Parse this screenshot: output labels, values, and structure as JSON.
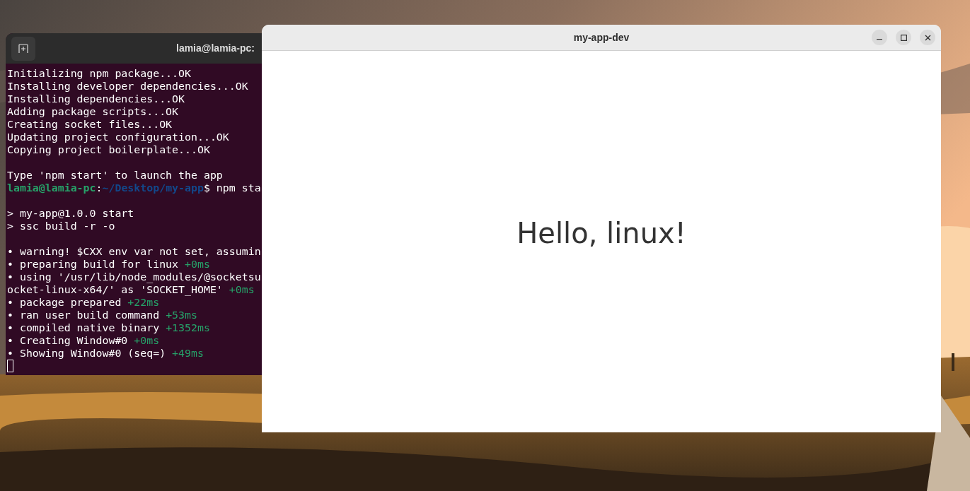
{
  "terminal": {
    "title": "lamia@lamia-pc:",
    "blocks": [
      [
        [
          {
            "text": "Initializing npm package...OK",
            "kind": "plain"
          }
        ],
        [
          {
            "text": "Installing developer dependencies...OK",
            "kind": "plain"
          }
        ],
        [
          {
            "text": "Installing dependencies...OK",
            "kind": "plain"
          }
        ],
        [
          {
            "text": "Adding package scripts...OK",
            "kind": "plain"
          }
        ],
        [
          {
            "text": "Creating socket files...OK",
            "kind": "plain"
          }
        ],
        [
          {
            "text": "Updating project configuration...OK",
            "kind": "plain"
          }
        ],
        [
          {
            "text": "Copying project boilerplate...OK",
            "kind": "plain"
          }
        ]
      ],
      [
        [
          {
            "text": "Type 'npm start' to launch the app",
            "kind": "plain"
          }
        ],
        [
          {
            "text": "lamia@lamia-pc",
            "kind": "user"
          },
          {
            "text": ":",
            "kind": "plain"
          },
          {
            "text": "~/Desktop/my-app",
            "kind": "path"
          },
          {
            "text": "$ npm sta",
            "kind": "plain"
          }
        ]
      ],
      [
        [
          {
            "text": "> my-app@1.0.0 start",
            "kind": "plain"
          }
        ],
        [
          {
            "text": "> ssc build -r -o",
            "kind": "plain"
          }
        ]
      ],
      [
        [
          {
            "text": "• warning! $CXX env var not set, assumin",
            "kind": "plain"
          }
        ],
        [
          {
            "text": "• preparing build for linux ",
            "kind": "plain"
          },
          {
            "text": "+0ms",
            "kind": "timing"
          }
        ],
        [
          {
            "text": "• using '/usr/lib/node_modules/@socketsu",
            "kind": "plain"
          }
        ],
        [
          {
            "text": "ocket-linux-x64/' as 'SOCKET_HOME' ",
            "kind": "plain"
          },
          {
            "text": "+0ms",
            "kind": "timing"
          }
        ],
        [
          {
            "text": "• package prepared ",
            "kind": "plain"
          },
          {
            "text": "+22ms",
            "kind": "timing"
          }
        ],
        [
          {
            "text": "• ran user build command ",
            "kind": "plain"
          },
          {
            "text": "+53ms",
            "kind": "timing"
          }
        ],
        [
          {
            "text": "• compiled native binary ",
            "kind": "plain"
          },
          {
            "text": "+1352ms",
            "kind": "timing"
          }
        ],
        [
          {
            "text": "• Creating Window#0 ",
            "kind": "plain"
          },
          {
            "text": "+0ms",
            "kind": "timing"
          }
        ],
        [
          {
            "text": "• Showing Window#0 (seq=) ",
            "kind": "plain"
          },
          {
            "text": "+49ms",
            "kind": "timing"
          }
        ]
      ]
    ]
  },
  "app_window": {
    "title": "my-app-dev",
    "content": "Hello, linux!"
  }
}
